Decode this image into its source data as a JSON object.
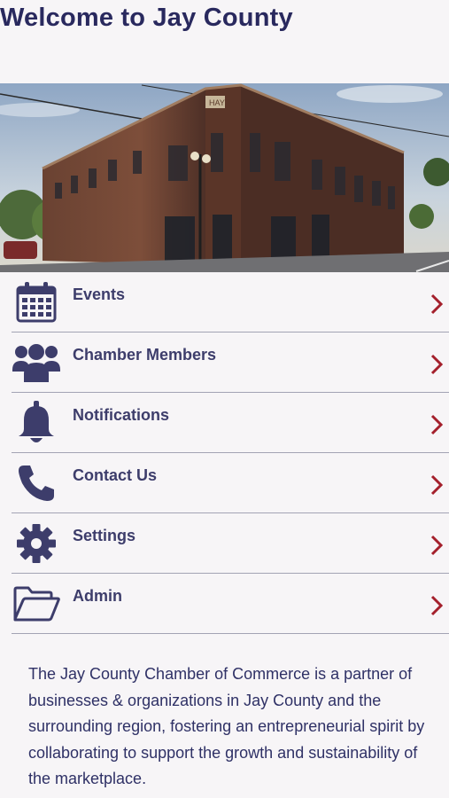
{
  "header": {
    "title": "Welcome to Jay County"
  },
  "hero": {
    "building_sign": "HAY"
  },
  "menu": {
    "items": [
      {
        "label": "Events",
        "icon": "calendar-icon"
      },
      {
        "label": "Chamber Members",
        "icon": "people-group-icon"
      },
      {
        "label": "Notifications",
        "icon": "bell-icon"
      },
      {
        "label": "Contact Us",
        "icon": "phone-icon"
      },
      {
        "label": "Settings",
        "icon": "gear-icon"
      },
      {
        "label": "Admin",
        "icon": "folder-open-icon"
      }
    ]
  },
  "about": {
    "text": "The Jay County Chamber of Commerce is a partner of businesses & organizations in Jay County and the surrounding region, fostering an entrepreneurial spirit by collaborating to support the growth and sustainability of the marketplace."
  },
  "colors": {
    "title": "#29295e",
    "icon": "#3d3d6b",
    "chevron": "#a4202c",
    "divider": "#a3a3b4",
    "background": "#f7f5f7"
  }
}
